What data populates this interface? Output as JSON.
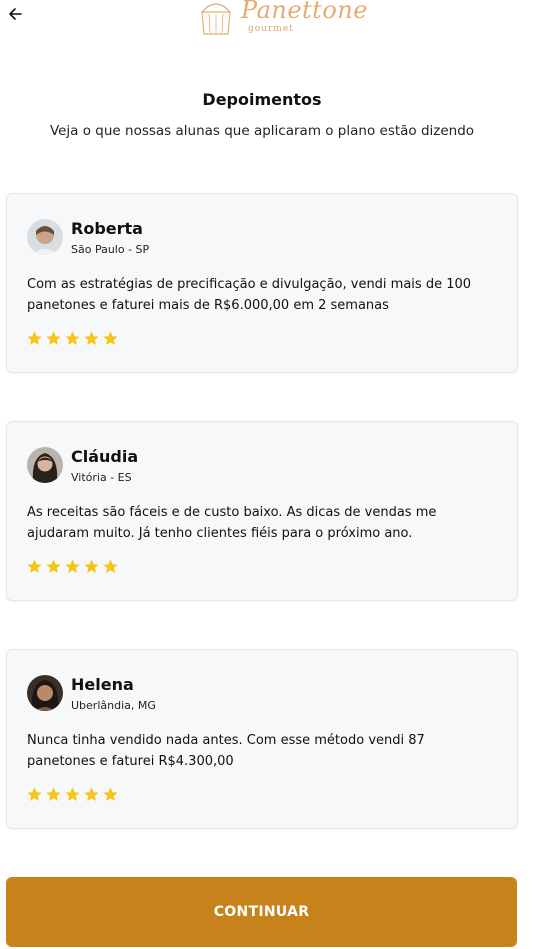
{
  "header": {
    "back_icon": "arrow-left-icon",
    "logo": {
      "name": "Panettone",
      "sub": "gourmet"
    }
  },
  "main": {
    "title": "Depoimentos",
    "subtitle": "Veja o que nossas alunas que aplicaram o plano estão dizendo"
  },
  "testimonials": [
    {
      "name": "Roberta",
      "location": "São Paulo - SP",
      "text": "Com as estratégias de precificação e divulgação, vendi mais de 100 panetones e faturei mais de R$6.000,00 em 2 semanas",
      "rating": 5
    },
    {
      "name": "Cláudia",
      "location": "Vitória - ES",
      "text": "As receitas são fáceis e de custo baixo. As dicas de vendas me ajudaram muito. Já tenho clientes fiéis para o próximo ano.",
      "rating": 5
    },
    {
      "name": "Helena",
      "location": "Uberlândia, MG",
      "text": "Nunca tinha vendido nada antes. Com esse método vendi 87 panetones e faturei R$4.300,00",
      "rating": 5
    }
  ],
  "cta": {
    "label": "CONTINUAR"
  },
  "colors": {
    "accent": "#c7821c",
    "star": "#f5c518",
    "logo": "#e2ad70"
  }
}
